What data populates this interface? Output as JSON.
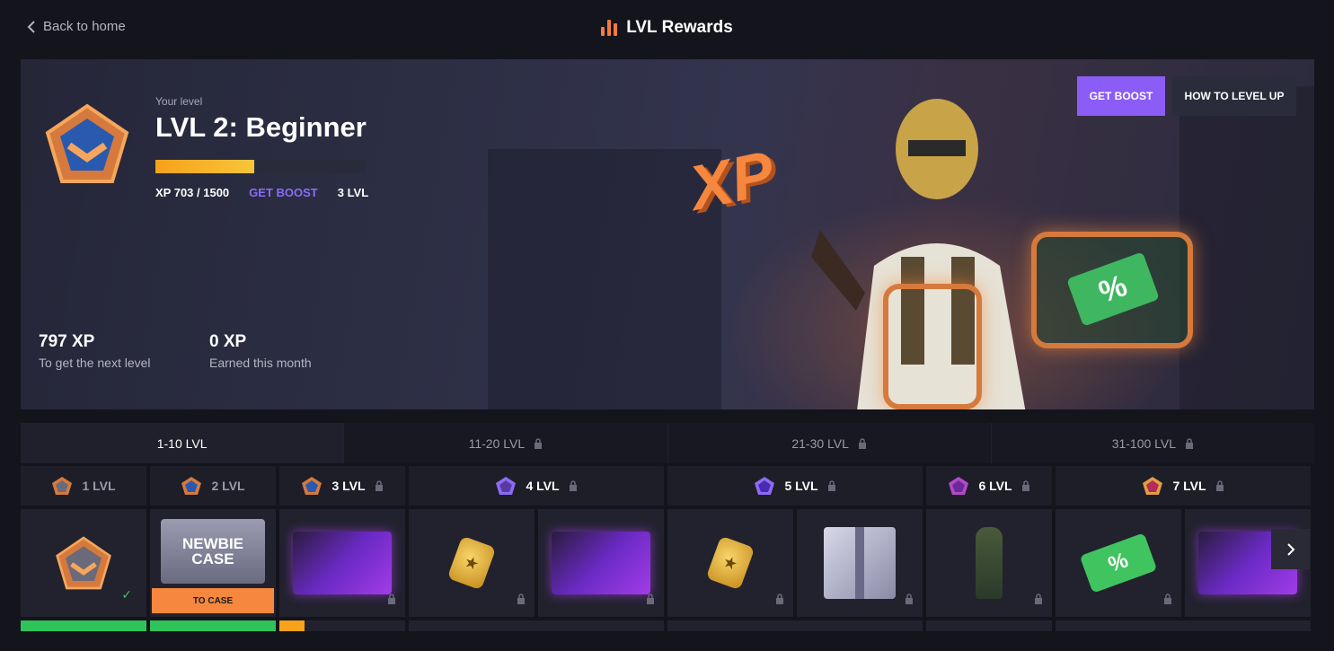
{
  "header": {
    "back_label": "Back to home",
    "title": "LVL Rewards"
  },
  "hero": {
    "your_level_label": "Your level",
    "level_title": "LVL 2: Beginner",
    "progress_fraction": 0.469,
    "xp_progress": "XP 703 / 1500",
    "get_boost_link": "GET BOOST",
    "next_level": "3 LVL",
    "art_text": "XP",
    "stats": [
      {
        "value": "797 XP",
        "label": "To get the next level"
      },
      {
        "value": "0 XP",
        "label": "Earned this month"
      }
    ],
    "buttons": {
      "get_boost": "GET BOOST",
      "how_to": "HOW TO LEVEL UP"
    }
  },
  "tabs": [
    {
      "label": "1-10 LVL",
      "locked": false,
      "active": true
    },
    {
      "label": "11-20 LVL",
      "locked": true,
      "active": false
    },
    {
      "label": "21-30 LVL",
      "locked": true,
      "active": false
    },
    {
      "label": "31-100 LVL",
      "locked": true,
      "active": false
    }
  ],
  "levels": [
    {
      "label": "1 LVL",
      "locked": false,
      "badge_color": "#d57a3c",
      "badge_inner": "#6a6a7a"
    },
    {
      "label": "2 LVL",
      "locked": false,
      "badge_color": "#d57a3c",
      "badge_inner": "#2a5ab0"
    },
    {
      "label": "3 LVL",
      "locked": true,
      "badge_color": "#d57a3c",
      "badge_inner": "#2a5ab0"
    },
    {
      "label": "4 LVL",
      "locked": true,
      "badge_color": "#8b6cf6",
      "badge_inner": "#5a3aa0"
    },
    {
      "label": "5 LVL",
      "locked": true,
      "badge_color": "#8b6cf6",
      "badge_inner": "#4a2ab0"
    },
    {
      "label": "6 LVL",
      "locked": true,
      "badge_color": "#b44ac8",
      "badge_inner": "#6a2a9a"
    },
    {
      "label": "7 LVL",
      "locked": true,
      "badge_color": "#e0a040",
      "badge_inner": "#b42a5a"
    }
  ],
  "rewards": {
    "newbie_case_text": "NEWBIE CASE",
    "to_case_label": "TO CASE",
    "ticket_text": "%"
  },
  "colors": {
    "accent_orange": "#f5873e",
    "accent_purple": "#8b5cf6",
    "progress_green": "#2fc45a",
    "progress_yellow": "#f6a21a"
  },
  "level_progress": [
    {
      "level": "1 LVL",
      "fraction": 1.0
    },
    {
      "level": "2 LVL",
      "fraction": 1.0
    },
    {
      "level": "3 LVL",
      "fraction": 0.2
    }
  ]
}
